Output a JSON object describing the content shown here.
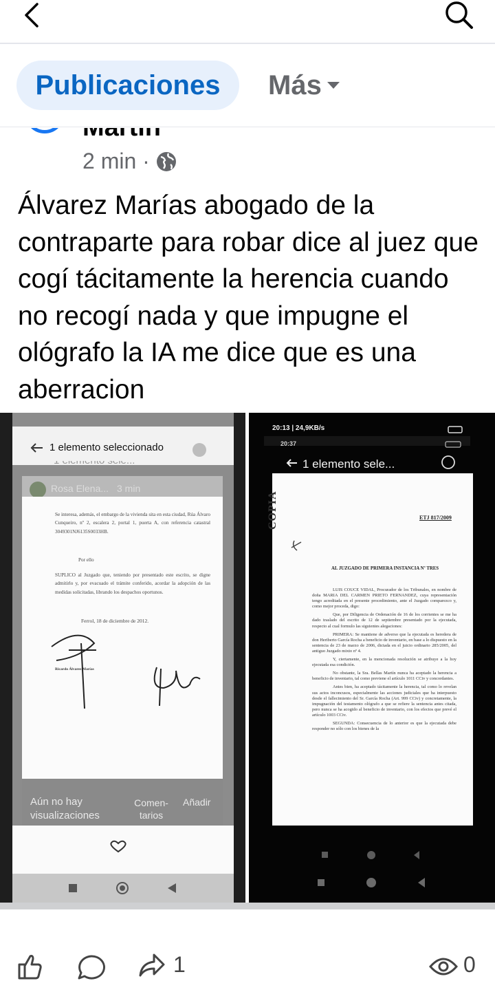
{
  "header": {
    "back_icon": "chevron-left-icon",
    "search_icon": "search-icon"
  },
  "tabs": {
    "active": "Publicaciones",
    "more": "Más"
  },
  "post": {
    "author": "Martín",
    "time": "2 min ·",
    "privacy_icon": "globe-icon",
    "text": "Álvarez Marías abogado de la contraparte para robar  dice al juez que cogí tácitamente la herencia cuando no recogí nada y que impugne el ológrafo la IA me dice que es una aberracion"
  },
  "image_left": {
    "selection_title": "1 elemento seleccionado",
    "ghost_title": "1 elemento sele...",
    "story_author": "Rosa Elena...",
    "story_time": "3 min",
    "paragraph_1": "Se interesa, además, el embargo de la vivienda sita en esta ciudad, Rúa Álvaro Cunqueiro, nº 2, escalera 2, portal 1, puerta A, con referencia catastral 3049301NJ6135S0033HB.",
    "por_ello": "Por ello",
    "suplico": "SUPLICO al Juzgado que, teniendo por presentado este escrito, se digne admitirlo y, por evacuado el trámite conferido, acordar la adopción de las medidas solicitadas, librando los despachos oportunos.",
    "date": "Ferrol, 18 de diciembre de 2012.",
    "signer": "Ricardo Álvarez Marías",
    "no_views": "Aún no hay visualizaciones",
    "comments": "Comen-tarios",
    "add": "Añadir"
  },
  "image_right": {
    "status_time": "20:13 | 24,9KB/s",
    "status_time_2": "20:37",
    "selection_title": "1 elemento sele...",
    "copia": "COPIA",
    "ref": "ETJ 817/2009",
    "heading": "AL JUZGADO DE PRIMERA INSTANCIA Nº TRES",
    "intro": "LUIS COUCE VIDAL, Procurador de los Tribunales, en nombre de doña MARIA DEL CARMEN PRIETO FERNANDEZ, cuya representación tengo acreditada en el presente procedimiento, ante el Juzgado comparezco y, como mejor proceda, digo:",
    "p1": "Que, por Diligencia de Ordenación de 16 de los corrientes se me ha dado traslado del escrito de 12 de septiembre presentado por la ejecutada, respecto al cual formulo las siguientes alegaciones:",
    "p2": "PRIMERA: Se mantiene de adverso que la ejecutada es heredera de don Heriberto García Rocha a beneficio de inventario, en base a lo dispuesto en la sentencia de 23 de marzo de 2006, dictada en el juicio ordinario 285/2005, del antiguo Juzgado mixto nº 4.",
    "p3": "Y, ciertamente, en la mencionada resolución se atribuye a la hoy ejecutada esa condición.",
    "p4": "No obstante, la Sra. Bellas Martín nunca ha aceptado la herencia a beneficio de inventario, tal como previene el artículo 1011 CCiv y concordantes.",
    "p5": "Antes bien, ha aceptado tácitamente la herencia, tal como lo revelan sus actos inconcusos, especialmente las acciones judiciales que ha interpuesto desde el fallecimiento del Sr. García Rocha (Art. 999 CCiv) y concretamente, la impugnación del testamento ológrafo a que se refiere la sentencia antes citada, pero nunca se ha acogido al beneficio de inventario, con los efectos que prevé el artículo 1003 CCiv.",
    "p6": "SEGUNDA: Consecuencia de lo anterior es que la ejecutada debe responder no sólo con los bienes de la"
  },
  "reactions": {
    "like_icon": "thumbs-up-icon",
    "comment_icon": "comment-icon",
    "share_icon": "share-icon",
    "share_count": "1",
    "views_icon": "eye-icon",
    "views_count": "0"
  }
}
